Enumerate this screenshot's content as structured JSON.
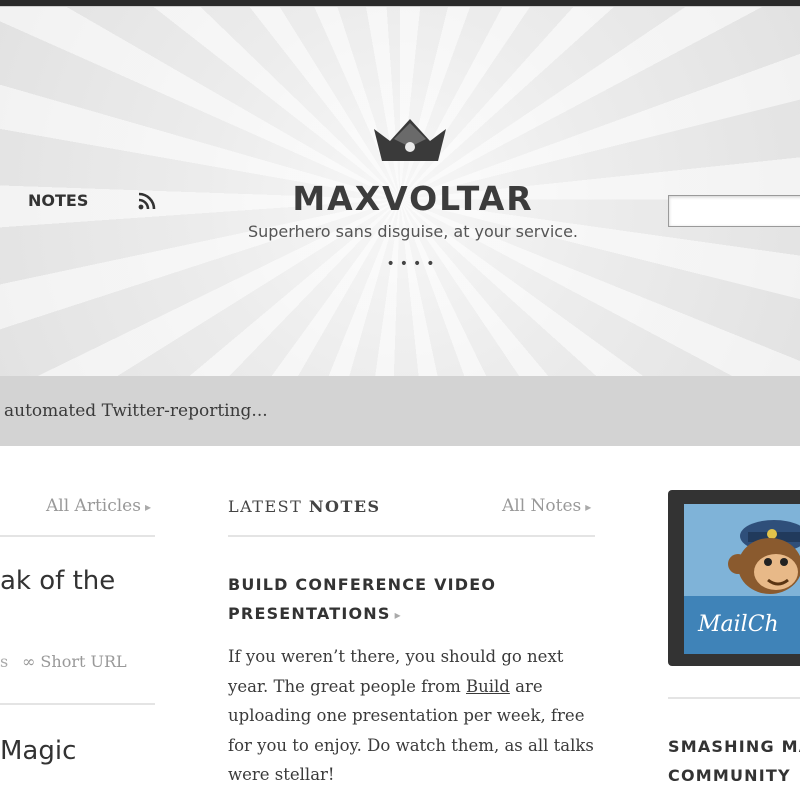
{
  "header": {
    "site_title": "MAXVOLTAR",
    "tagline": "Superhero sans disguise, at your service.",
    "dots": "••••",
    "nav": {
      "notes_label": "NOTES"
    },
    "search": {
      "value": ""
    }
  },
  "ticker": {
    "text": "automated Twitter-reporting..."
  },
  "articles": {
    "all_label": "All Articles",
    "title_1": "ak of the",
    "meta_fragment": "s",
    "short_url_label": "Short URL",
    "title_2": "Magic"
  },
  "notes": {
    "heading_prefix": "LATEST",
    "heading_bold": "NOTES",
    "all_label": "All Notes",
    "note_title": "BUILD CONFERENCE VIDEO PRESENTATIONS",
    "body_before_link": "If you weren’t there, you should go next year. The great people from ",
    "body_link": "Build",
    "body_after_link": " are uploading one presentation per week, free for you to enjoy. Do watch them, as all talks were stellar!"
  },
  "sidebar": {
    "ad_text": "MailCh",
    "heading_line_1": "SMASHING MA",
    "heading_line_2": "COMMUNITY"
  },
  "colors": {
    "ticker_bg": "#d3d3d3",
    "ad_blue": "#3f83b8",
    "text_dark": "#333333",
    "link_muted": "#999999"
  }
}
